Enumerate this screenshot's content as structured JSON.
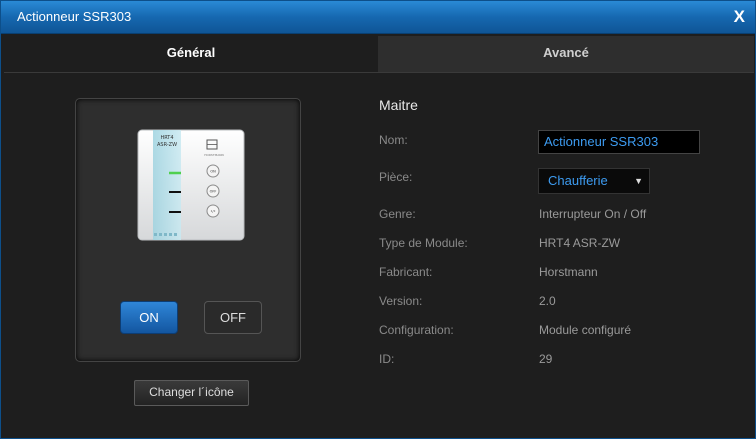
{
  "window": {
    "title": "Actionneur SSR303",
    "close_label": "X"
  },
  "tabs": [
    {
      "label": "Général",
      "active": true
    },
    {
      "label": "Avancé",
      "active": false
    }
  ],
  "device": {
    "panel_text_1": "HRT4",
    "panel_text_2": "ASR-ZW",
    "brand_text": "HORSTMANN",
    "key_on": "ON",
    "key_off": "OFF",
    "key_third": "•/•"
  },
  "buttons": {
    "on": "ON",
    "off": "OFF",
    "change_icon": "Changer l´icône"
  },
  "details": {
    "section_title": "Maitre",
    "name_label": "Nom:",
    "name_value": "Actionneur SSR303",
    "room_label": "Pièce:",
    "room_value": "Chaufferie",
    "genre_label": "Genre:",
    "genre_value": "Interrupteur On / Off",
    "module_type_label": "Type de Module:",
    "module_type_value": "HRT4 ASR-ZW",
    "manufacturer_label": "Fabricant:",
    "manufacturer_value": "Horstmann",
    "version_label": "Version:",
    "version_value": "2.0",
    "configuration_label": "Configuration:",
    "configuration_value": "Module configuré",
    "id_label": "ID:",
    "id_value": "29"
  },
  "colors": {
    "accent": "#1f6fc2",
    "title_bar": "#1668b0",
    "value_blue": "#3d9bf0",
    "status_green": "#4fd04f"
  }
}
